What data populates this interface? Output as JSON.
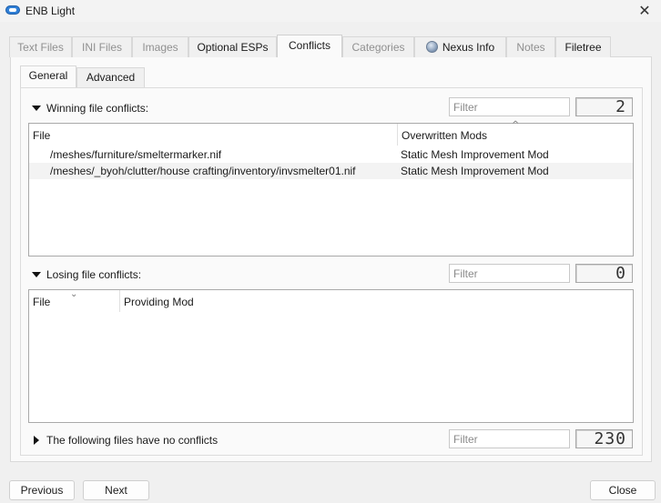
{
  "window": {
    "title": "ENB Light",
    "close_glyph": "✕"
  },
  "tabs": [
    {
      "label": "Text Files",
      "state": "disabled"
    },
    {
      "label": "INI Files",
      "state": "disabled"
    },
    {
      "label": "Images",
      "state": "disabled"
    },
    {
      "label": "Optional ESPs",
      "state": "normal"
    },
    {
      "label": "Conflicts",
      "state": "active"
    },
    {
      "label": "Categories",
      "state": "disabled"
    },
    {
      "label": "Nexus Info",
      "state": "normal",
      "icon": "globe-icon"
    },
    {
      "label": "Notes",
      "state": "disabled"
    },
    {
      "label": "Filetree",
      "state": "normal"
    }
  ],
  "subtabs": [
    {
      "label": "General",
      "state": "active"
    },
    {
      "label": "Advanced",
      "state": "normal"
    }
  ],
  "winning": {
    "label": "Winning file conflicts:",
    "filter_placeholder": "Filter",
    "count": "2",
    "columns": [
      "File",
      "Overwritten Mods"
    ],
    "rows": [
      {
        "file": "/meshes/furniture/smeltermarker.nif",
        "mod": "Static Mesh Improvement Mod"
      },
      {
        "file": "/meshes/_byoh/clutter/house crafting/inventory/invsmelter01.nif",
        "mod": "Static Mesh Improvement Mod"
      }
    ]
  },
  "losing": {
    "label": "Losing file conflicts:",
    "filter_placeholder": "Filter",
    "count": "0",
    "columns": [
      "File",
      "Providing Mod"
    ]
  },
  "noconflict": {
    "label": "The following files have no conflicts",
    "filter_placeholder": "Filter",
    "count": "230"
  },
  "buttons": {
    "previous": "Previous",
    "next": "Next",
    "close": "Close"
  }
}
